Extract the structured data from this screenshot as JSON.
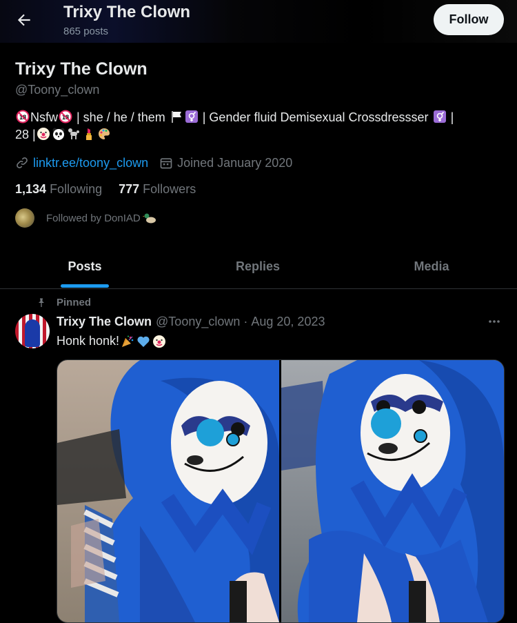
{
  "header": {
    "title": "Trixy The Clown",
    "subtitle": "865 posts",
    "follow_label": "Follow"
  },
  "profile": {
    "name": "Trixy The Clown",
    "handle": "@Toony_clown",
    "bio_line1_a": "Nsfw",
    "bio_line1_b": " | she / he / them ",
    "bio_line1_c": " | Gender fluid Demisexual Crossdressser ",
    "bio_line1_d": " |",
    "bio_line2_a": "28 |",
    "link": "linktr.ee/toony_clown",
    "joined": "Joined January 2020",
    "following_count": "1,134",
    "following_label": "Following",
    "followers_count": "777",
    "followers_label": "Followers",
    "followed_by": "Followed by DonIAD"
  },
  "tabs": [
    {
      "label": "Posts",
      "active": true
    },
    {
      "label": "Replies",
      "active": false
    },
    {
      "label": "Media",
      "active": false
    }
  ],
  "tweet": {
    "pinned_label": "Pinned",
    "author_name": "Trixy The Clown",
    "author_handle": "@Toony_clown",
    "separator": "·",
    "date": "Aug 20, 2023",
    "text": "Honk honk!"
  },
  "colors": {
    "accent": "#1d9bf0",
    "text": "#e7e9ea",
    "muted": "#71767b",
    "background": "#000000"
  }
}
